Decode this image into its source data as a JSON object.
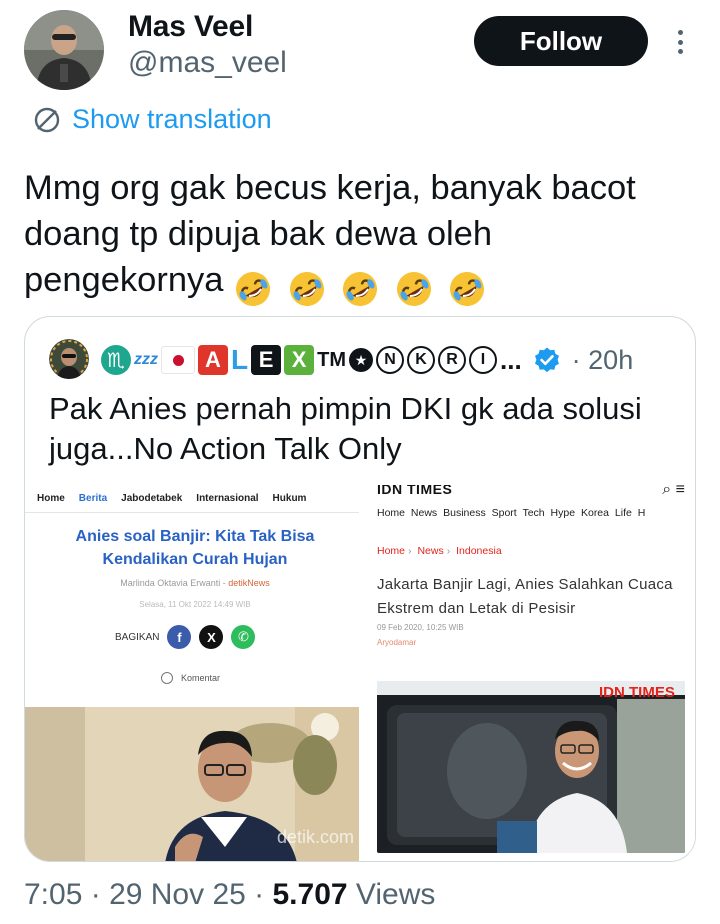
{
  "header": {
    "display_name": "Mas Veel",
    "handle": "@mas_veel",
    "follow_label": "Follow"
  },
  "translate": {
    "label": "Show translation"
  },
  "tweet": {
    "text": "Mmg org gak becus kerja, banyak bacot doang tp dipuja bak dewa oleh pengekornya",
    "emoji_name": "rolling-on-the-floor-laughing",
    "emoji_count": 5
  },
  "quote": {
    "name_letters": [
      "A",
      "L",
      "E",
      "X"
    ],
    "name_tm": "TM",
    "name_circled": [
      "N",
      "K",
      "R",
      "I"
    ],
    "ellipsis": "...",
    "time": "· 20h",
    "text": "Pak Anies pernah pimpin DKI gk ada solusi juga...No Action Talk Only"
  },
  "left_article": {
    "nav": [
      "Home",
      "Berita",
      "Jabodetabek",
      "Internasional",
      "Hukum"
    ],
    "active_nav": "Berita",
    "title": "Anies soal Banjir: Kita Tak Bisa Kendalikan Curah Hujan",
    "author": "Marlinda Oktavia Erwanti",
    "source": "detikNews",
    "date": "Selasa, 11 Okt 2022 14:49 WIB",
    "share_label": "BAGIKAN",
    "comment_label": "Komentar",
    "watermark": "detik.com"
  },
  "right_article": {
    "brand": "IDN TIMES",
    "nav": "Home News Business Sport Tech Hype Korea Life H",
    "breadcrumb": [
      "Home",
      "News",
      "Indonesia"
    ],
    "title": "Jakarta Banjir Lagi, Anies Salahkan Cuaca Ekstrem dan Letak di Pesisir",
    "date": "09 Feb 2020, 10:25 WIB",
    "author": "Aryodamar",
    "photo_watermark": "IDN TIMES"
  },
  "meta": {
    "time": "7:05",
    "date": "29 Nov 25",
    "views_count": "5.707",
    "views_label": "Views"
  },
  "colors": {
    "link_blue": "#1d9bf0",
    "follow_bg": "#0f1419",
    "secondary_text": "#536471",
    "verified": "#1d9bf0",
    "detik_blue": "#2a62c4",
    "idn_red": "#e2241b"
  }
}
